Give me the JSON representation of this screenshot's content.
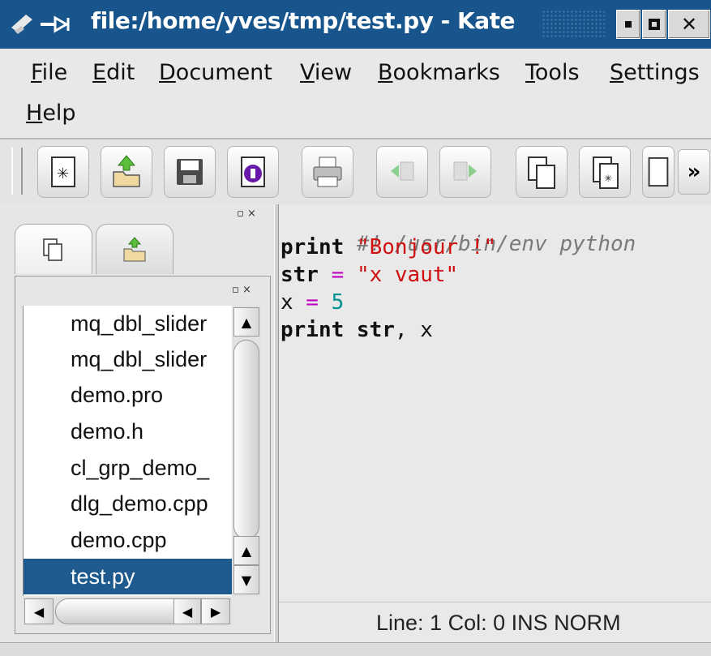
{
  "window": {
    "title": "file:/home/yves/tmp/test.py - Kate",
    "buttons": [
      "minimize",
      "maximize",
      "close"
    ]
  },
  "menubar": {
    "items": [
      "File",
      "Edit",
      "Document",
      "View",
      "Bookmarks",
      "Tools",
      "Settings",
      "Help"
    ]
  },
  "toolbar": {
    "buttons": [
      {
        "name": "new-document-icon"
      },
      {
        "name": "open-document-icon"
      },
      {
        "name": "save-document-icon"
      },
      {
        "name": "close-document-icon"
      },
      {
        "name": "print-icon"
      },
      {
        "name": "undo-icon"
      },
      {
        "name": "redo-icon"
      },
      {
        "name": "copy-icon"
      },
      {
        "name": "new-file-icon"
      },
      {
        "name": "paste-icon"
      }
    ],
    "more_label": "»"
  },
  "sidebar": {
    "tabs": [
      {
        "icon": "document-list-icon"
      },
      {
        "icon": "file-selector-icon"
      }
    ],
    "dock_controls": "▫ ×",
    "files": [
      "mq_dbl_slider",
      "mq_dbl_slider",
      "demo.pro",
      "demo.h",
      "cl_grp_demo_",
      "dlg_demo.cpp",
      "demo.cpp",
      "test.py"
    ],
    "selected_file": "test.py"
  },
  "editor": {
    "lines": [
      {
        "comment": "#! /usr/bin/env python"
      },
      {
        "kw": "print",
        "space": " ",
        "str": "\"Bonjour !\""
      },
      {
        "kw": "str",
        "op": " = ",
        "str": "\"x vaut\""
      },
      {
        "plain": "x",
        "op": " = ",
        "num": "5"
      },
      {
        "kw": "print str",
        "plain": ", x"
      }
    ]
  },
  "statusbar": {
    "text": "Line: 1 Col: 0  INS  NORM"
  },
  "colors": {
    "titlebar": "#18558c",
    "selection": "#1e5a8e",
    "string": "#d01010",
    "operator": "#c000c0",
    "number": "#009090",
    "comment": "#7a7a7a"
  }
}
